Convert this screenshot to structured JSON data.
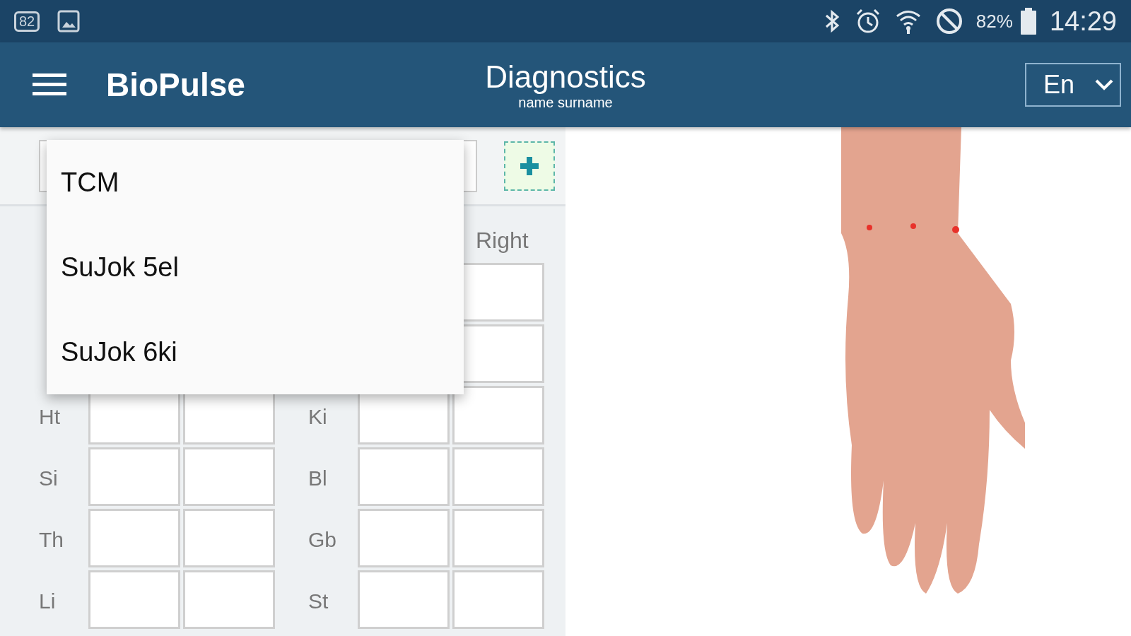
{
  "status_bar": {
    "notification_count": "82",
    "battery": "82%",
    "time": "14:29"
  },
  "app_bar": {
    "app_name": "BioPulse",
    "title": "Diagnostics",
    "subtitle": "name surname",
    "language": "En"
  },
  "method_dropdown": {
    "expanded": true,
    "options": [
      {
        "label": "TCM",
        "selected": false
      },
      {
        "label": "SuJok 5el",
        "selected": false
      },
      {
        "label": "SuJok 6ki",
        "selected": false
      }
    ]
  },
  "pulse_grid": {
    "right_header": "Right",
    "rows": [
      {},
      {},
      {
        "left_label": "Ht",
        "right_label": "Ki"
      },
      {
        "left_label": "Si",
        "right_label": "Bl"
      },
      {
        "left_label": "Th",
        "right_label": "Gb"
      },
      {
        "left_label": "Li",
        "right_label": "St"
      }
    ]
  }
}
